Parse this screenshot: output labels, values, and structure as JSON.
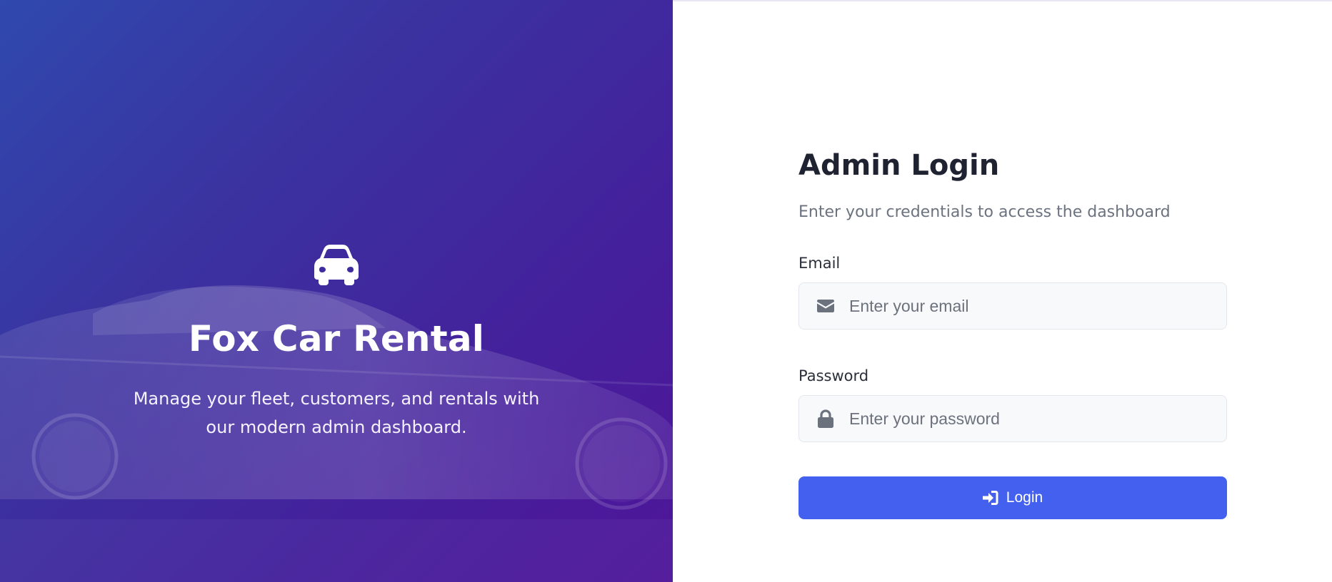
{
  "colors": {
    "hero_gradient_start": "#2f49ae",
    "hero_gradient_end": "#4f159a",
    "accent": "#4361ee",
    "title_text": "#1f2230",
    "muted_text": "#6b7280",
    "input_background": "#f8f9fb"
  },
  "hero": {
    "icon": "car-icon",
    "title": "Fox Car Rental",
    "tagline": "Manage your fleet, customers, and rentals with our modern admin dashboard."
  },
  "login": {
    "title": "Admin Login",
    "subtitle": "Enter your credentials to access the dashboard",
    "email": {
      "label": "Email",
      "icon": "envelope-icon",
      "placeholder": "Enter your email",
      "value": ""
    },
    "password": {
      "label": "Password",
      "icon": "lock-icon",
      "placeholder": "Enter your password",
      "value": ""
    },
    "button": {
      "icon": "sign-in-icon",
      "label": "Login"
    }
  }
}
